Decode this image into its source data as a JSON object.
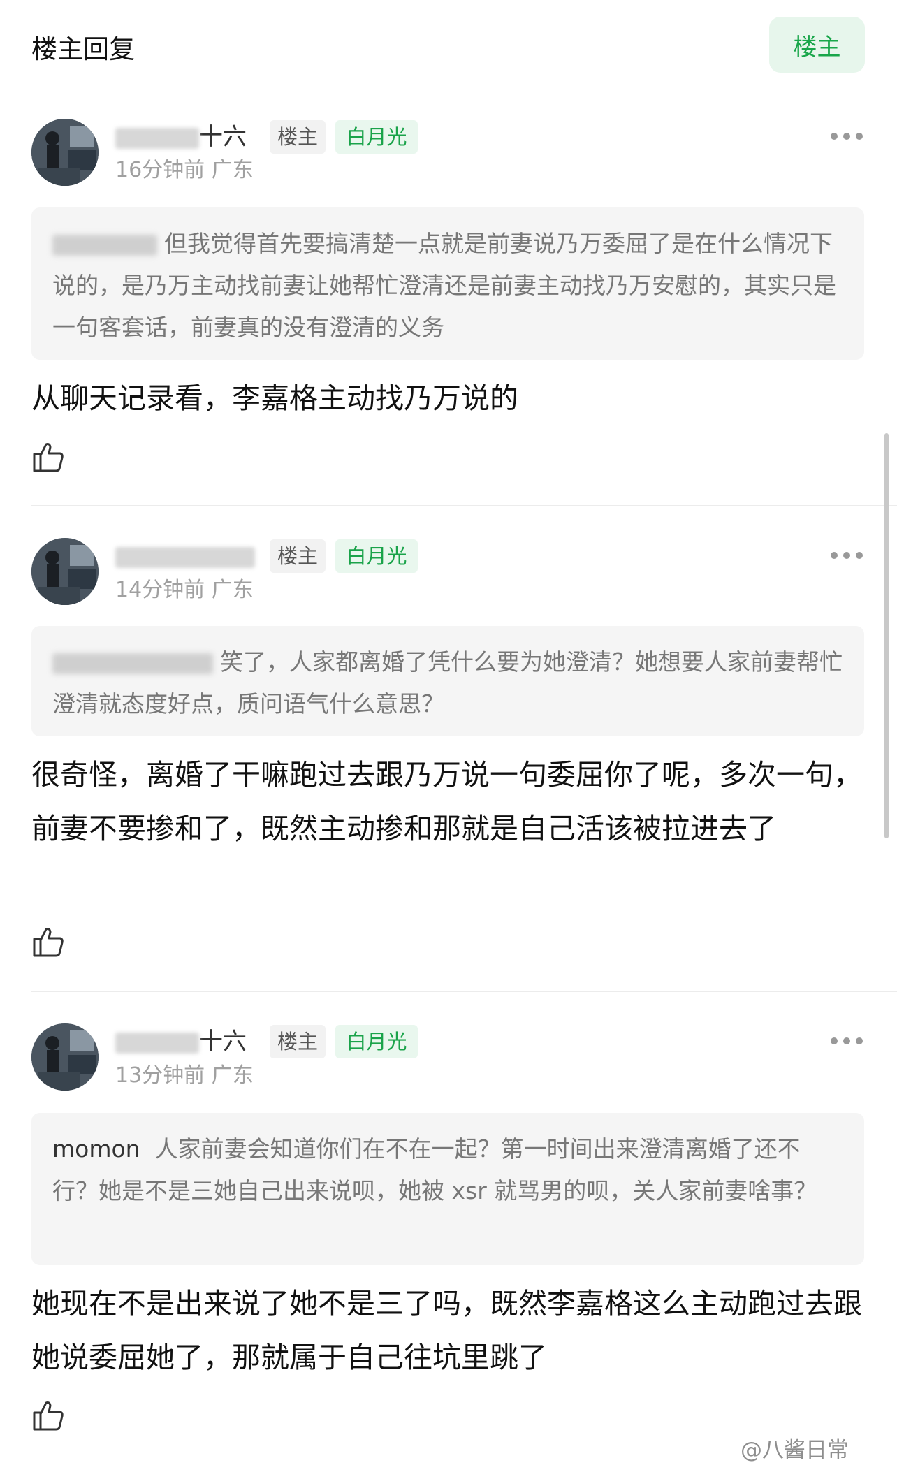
{
  "header": {
    "title": "楼主回复",
    "op_button": "楼主"
  },
  "comments": [
    {
      "username_visible": "十六",
      "op_tag": "楼主",
      "badge": "白月光",
      "meta": "16分钟前 广东",
      "quote_user": "",
      "quote_text": "但我觉得首先要搞清楚一点就是前妻说乃万委屈了是在什么情况下说的，是乃万主动找前妻让她帮忙澄清还是前妻主动找乃万安慰的，其实只是一句客套话，前妻真的没有澄清的义务",
      "body": "从聊天记录看，李嘉格主动找乃万说的"
    },
    {
      "username_visible": "",
      "op_tag": "楼主",
      "badge": "白月光",
      "meta": "14分钟前 广东",
      "quote_user": "",
      "quote_text": "笑了，人家都离婚了凭什么要为她澄清？她想要人家前妻帮忙澄清就态度好点，质问语气什么意思？",
      "body": "很奇怪，离婚了干嘛跑过去跟乃万说一句委屈你了呢，多次一句，前妻不要掺和了，既然主动掺和那就是自己活该被拉进去了"
    },
    {
      "username_visible": "十六",
      "op_tag": "楼主",
      "badge": "白月光",
      "meta": "13分钟前 广东",
      "quote_user": "momon",
      "quote_text": "人家前妻会知道你们在不在一起？第一时间出来澄清离婚了还不行？她是不是三她自己出来说呗，她被 xsr 就骂男的呗，关人家前妻啥事？",
      "body": "她现在不是出来说了她不是三了吗，既然李嘉格这么主动跑过去跟她说委屈她了，那就属于自己往坑里跳了"
    }
  ],
  "watermark": "@八酱日常",
  "icons": {
    "more": "more-icon",
    "like": "thumbs-up-icon",
    "avatar": "avatar"
  },
  "colors": {
    "accent_green": "#19a64a",
    "badge_bg": "#e9f7ee",
    "quote_bg": "#f5f5f5",
    "meta_gray": "#a0a0a0"
  }
}
